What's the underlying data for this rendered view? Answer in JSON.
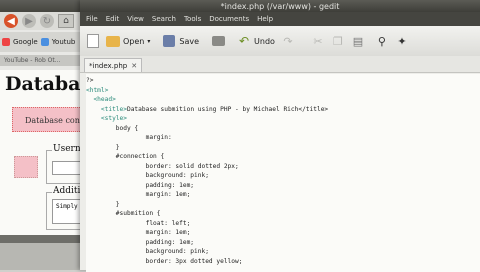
{
  "browser": {
    "bookmarks": [
      {
        "label": "Google",
        "icon": "google-icon"
      },
      {
        "label": "Youtub",
        "icon": "youtube-icon"
      }
    ],
    "tab_label": "YouTube - Rob Ot...",
    "page_title": "Databas",
    "connection_text": "Database con",
    "legend_username": "Userna",
    "legend_addition": "Additi",
    "textarea_value": "Simply"
  },
  "gedit": {
    "window_title": "*index.php (/var/www) - gedit",
    "menu": [
      "File",
      "Edit",
      "View",
      "Search",
      "Tools",
      "Documents",
      "Help"
    ],
    "toolbar": {
      "open_label": "Open",
      "save_label": "Save",
      "undo_label": "Undo"
    },
    "tab_label": "*index.php",
    "code_lines": [
      {
        "indent": "",
        "pre": "?>",
        "tag": "",
        "post": ""
      },
      {
        "indent": "",
        "pre": "",
        "tag": "<html>",
        "post": ""
      },
      {
        "indent": "  ",
        "pre": "",
        "tag": "<head>",
        "post": ""
      },
      {
        "indent": "    ",
        "pre": "",
        "tag": "<title>",
        "post": "Database submition using PHP - by Michael Rich</title>"
      },
      {
        "indent": "    ",
        "pre": "",
        "tag": "<style>",
        "post": ""
      },
      {
        "indent": "        ",
        "pre": "body {",
        "tag": "",
        "post": ""
      },
      {
        "indent": "                ",
        "pre": "margin:",
        "tag": "",
        "post": ""
      },
      {
        "indent": "        ",
        "pre": "}",
        "tag": "",
        "post": ""
      },
      {
        "indent": "        ",
        "pre": "#connection {",
        "tag": "",
        "post": ""
      },
      {
        "indent": "                ",
        "pre": "border: solid dotted 2px;",
        "tag": "",
        "post": ""
      },
      {
        "indent": "                ",
        "pre": "background: pink;",
        "tag": "",
        "post": ""
      },
      {
        "indent": "                ",
        "pre": "padding: 1em;",
        "tag": "",
        "post": ""
      },
      {
        "indent": "                ",
        "pre": "margin: 1em;",
        "tag": "",
        "post": ""
      },
      {
        "indent": "        ",
        "pre": "}",
        "tag": "",
        "post": ""
      },
      {
        "indent": "        ",
        "pre": "#submition {",
        "tag": "",
        "post": ""
      },
      {
        "indent": "                ",
        "pre": "float: left;",
        "tag": "",
        "post": ""
      },
      {
        "indent": "                ",
        "pre": "margin: 1em;",
        "tag": "",
        "post": ""
      },
      {
        "indent": "                ",
        "pre": "padding: 1em;",
        "tag": "",
        "post": ""
      },
      {
        "indent": "                ",
        "pre": "background: pink;",
        "tag": "",
        "post": ""
      },
      {
        "indent": "                ",
        "pre": "border: 3px dotted yellow;",
        "tag": "",
        "post": ""
      }
    ]
  }
}
